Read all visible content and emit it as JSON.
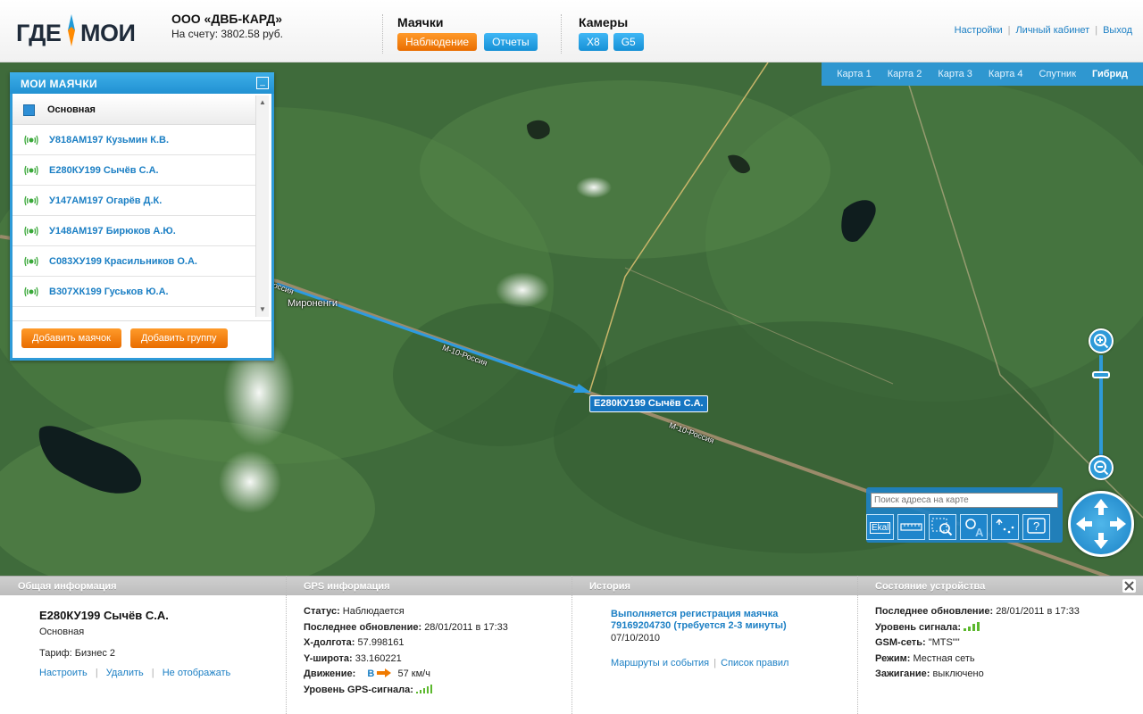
{
  "header": {
    "logo_left": "ГДЕ",
    "logo_right": "МОИ",
    "company_name": "ООО «ДВБ-КАРД»",
    "balance": "На счету: 3802.58 руб.",
    "beacons_title": "Маячки",
    "beacons_buttons": [
      "Наблюдение",
      "Отчеты"
    ],
    "cameras_title": "Камеры",
    "cameras_buttons": [
      "X8",
      "G5"
    ],
    "links": [
      "Настройки",
      "Личный кабинет",
      "Выход"
    ]
  },
  "map": {
    "tabs": [
      "Карта 1",
      "Карта 2",
      "Карта 3",
      "Карта 4",
      "Спутник",
      "Гибрид"
    ],
    "active_tab": "Гибрид",
    "search_placeholder": "Поиск адреса на карте",
    "tools": [
      "ruler-icon",
      "scale-icon",
      "zoom-area-icon",
      "zoom-text-icon",
      "route-icon",
      "help-icon"
    ],
    "tool_ekal": "Ekal",
    "labels": {
      "town": "Мироненги",
      "road1": "М-10-Россия",
      "road2": "М-10-Россия",
      "road3": "Россия"
    },
    "marker": "Е280КУ199 Сычёв С.А."
  },
  "beacons_panel": {
    "title": "МОИ МАЯЧКИ",
    "group": "Основная",
    "items": [
      "У818АМ197 Кузьмин К.В.",
      "Е280КУ199 Сычёв С.А.",
      "У147АМ197 Огарёв Д.К.",
      "У148АМ197 Бирюков А.Ю.",
      "С083ХУ199 Красильников О.А.",
      "В307ХК199 Гуськов Ю.А."
    ],
    "add_beacon": "Добавить маячок",
    "add_group": "Добавить группу"
  },
  "info": {
    "headers": [
      "Общая информация",
      "GPS информация",
      "История",
      "Состояние устройства"
    ],
    "general": {
      "name": "Е280КУ199 Сычёв С.А.",
      "group": "Основная",
      "tariff": "Тариф: Бизнес 2",
      "links": [
        "Настроить",
        "Удалить",
        "Не отображать"
      ]
    },
    "gps": {
      "status_label": "Статус:",
      "status": "Наблюдается",
      "updated_label": "Последнее обновление:",
      "updated": "28/01/2011 в 17:33",
      "lon_label": "X-долгота:",
      "lon": "57.998161",
      "lat_label": "Y-широта:",
      "lat": "33.160221",
      "motion_label": "Движение:",
      "motion_dir": "В",
      "motion_speed": "57 км/ч",
      "signal_label": "Уровень GPS-сигнала:"
    },
    "history": {
      "notice": "Выполняется регистрация маячка 79169204730 (требуется 2-3 минуты)",
      "date": "07/10/2010",
      "links": [
        "Маршруты и события",
        "Список правил"
      ]
    },
    "device": {
      "updated_label": "Последнее обновление:",
      "updated": "28/01/2011 в 17:33",
      "signal_label": "Уровень сигнала:",
      "gsm_label": "GSM-сеть:",
      "gsm": "\"MTS\"\"",
      "mode_label": "Режим:",
      "mode": "Местная сеть",
      "ignition_label": "Зажигание:",
      "ignition": "выключено"
    }
  },
  "colors": {
    "accent_blue": "#2e9ad8",
    "orange": "#f07a00",
    "link_blue": "#1b7fc4",
    "signal_green": "#5cb82e"
  }
}
